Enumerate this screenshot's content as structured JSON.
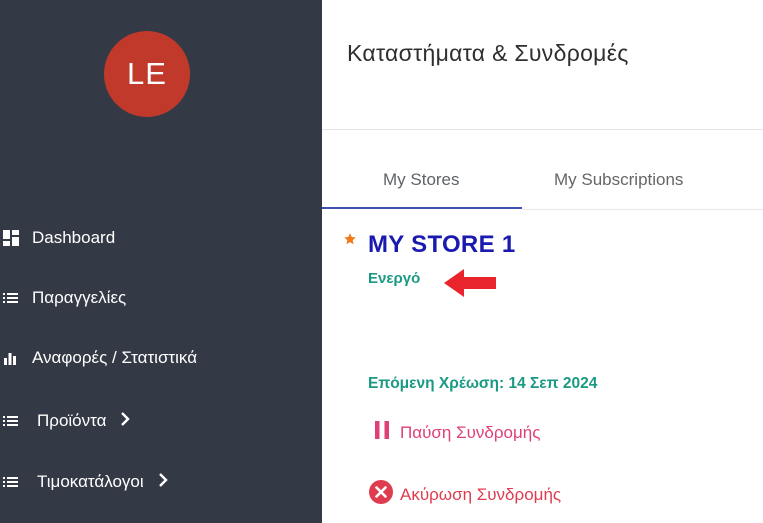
{
  "sidebar": {
    "avatar_initials": "LE",
    "items": [
      {
        "label": "Dashboard",
        "icon": "dashboard-grid-icon"
      },
      {
        "label": "Παραγγελίες",
        "icon": "list-icon"
      },
      {
        "label": "Αναφορές / Στατιστικά",
        "icon": "bar-chart-icon"
      },
      {
        "label": "Προϊόντα",
        "icon": "list-icon",
        "has_submenu": true
      },
      {
        "label": "Τιμοκατάλογοι",
        "icon": "list-icon",
        "has_submenu": true
      }
    ]
  },
  "header": {
    "title": "Καταστήματα & Συνδρομές"
  },
  "tabs": [
    {
      "label": "My Stores",
      "active": true
    },
    {
      "label": "My Subscriptions",
      "active": false
    }
  ],
  "store": {
    "name": "MY STORE 1",
    "status": "Ενεργό",
    "next_charge": "Επόμενη Χρέωση: 14 Σεπ 2024",
    "pause_label": "Παύση Συνδρομής",
    "cancel_label": "Ακύρωση Συνδρομής"
  },
  "colors": {
    "sidebar_bg": "#343a45",
    "avatar_bg": "#c0392b",
    "tab_accent": "#3f51b5",
    "store_name": "#1a1ab0",
    "status_green": "#1a9a84",
    "pause_pink": "#e0407a",
    "cancel_red": "#e03c50",
    "star_orange": "#f07a1a",
    "annotation_arrow": "#e8242c"
  }
}
